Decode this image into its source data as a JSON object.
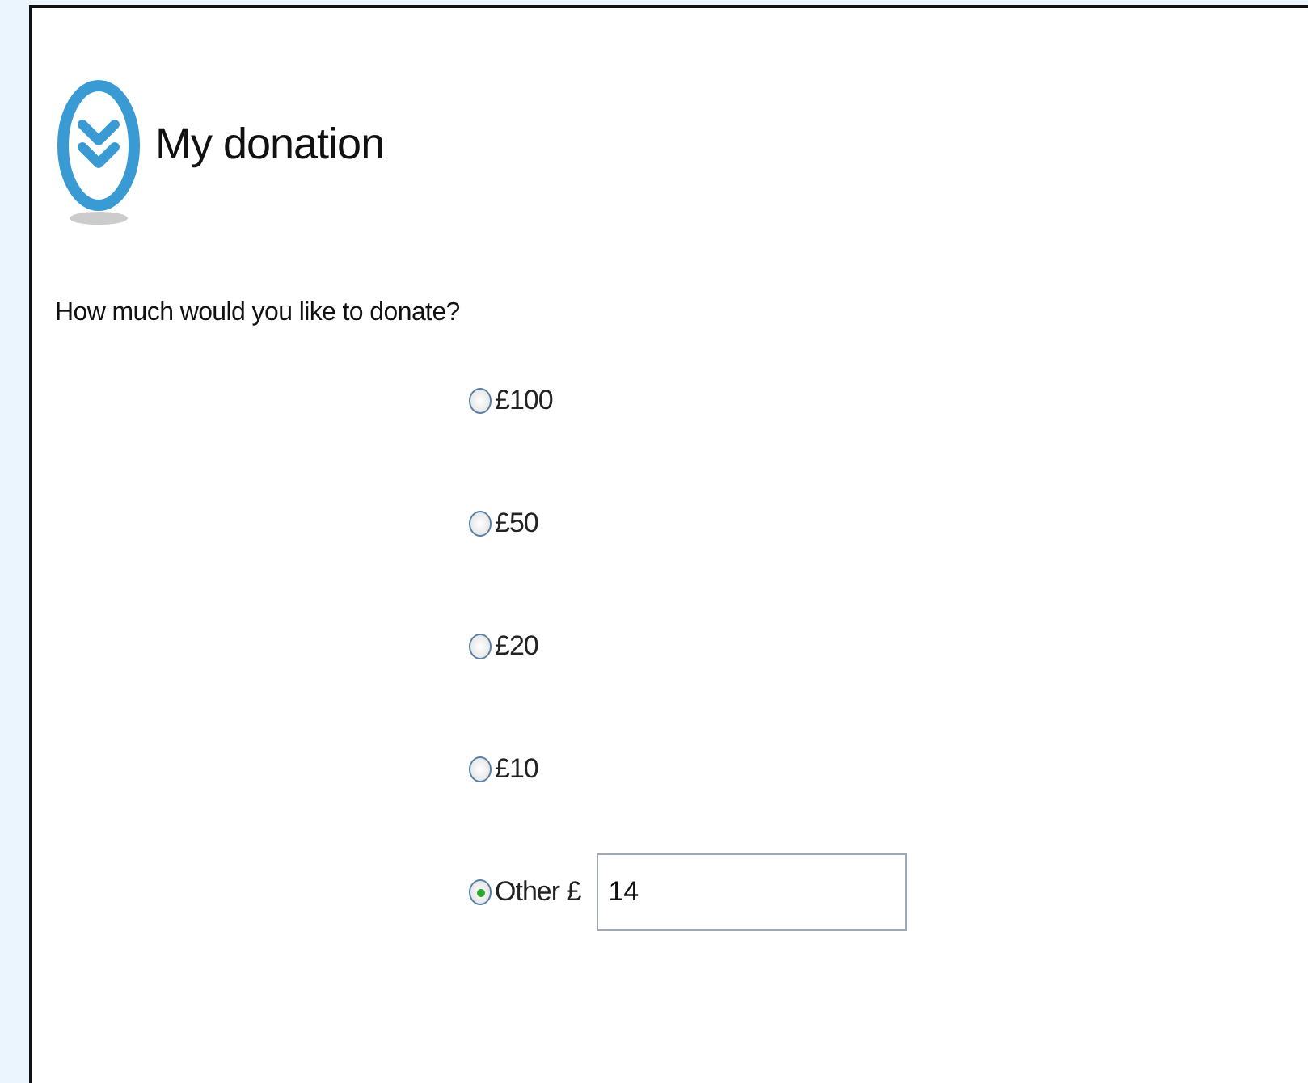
{
  "title": "My donation",
  "question": "How much would you like to donate?",
  "options": [
    {
      "kind": "amount",
      "label": "£100",
      "selected": false
    },
    {
      "kind": "amount",
      "label": "£50",
      "selected": false
    },
    {
      "kind": "amount",
      "label": "£20",
      "selected": false
    },
    {
      "kind": "amount",
      "label": "£10",
      "selected": false
    },
    {
      "kind": "other",
      "label": "Other £",
      "selected": true,
      "value": "14"
    }
  ]
}
